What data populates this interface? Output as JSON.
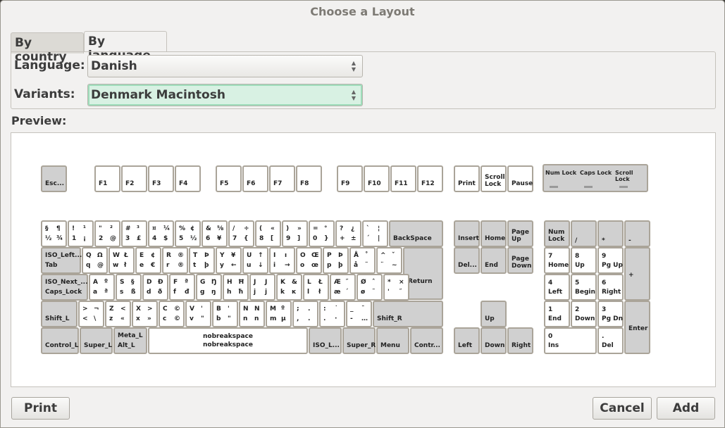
{
  "window": {
    "title": "Choose a Layout"
  },
  "tabs": [
    {
      "label": "By country"
    },
    {
      "label": "By language"
    }
  ],
  "language": {
    "label": "Language:",
    "value": "Danish"
  },
  "variants": {
    "label": "Variants:",
    "value": "Denmark Macintosh"
  },
  "preview": {
    "label": "Preview:"
  },
  "buttons": {
    "print": "Print",
    "cancel": "Cancel",
    "add": "Add"
  },
  "keyboard": {
    "indicators": [
      "Num Lock",
      "Caps Lock",
      "Scroll Lock"
    ],
    "function_row": [
      [
        "Esc...",
        ""
      ],
      [
        "F1",
        ""
      ],
      [
        "F2",
        ""
      ],
      [
        "F3",
        ""
      ],
      [
        "F4",
        ""
      ],
      [
        "F5",
        ""
      ],
      [
        "F6",
        ""
      ],
      [
        "F7",
        ""
      ],
      [
        "F8",
        ""
      ],
      [
        "F9",
        ""
      ],
      [
        "F10",
        ""
      ],
      [
        "F11",
        ""
      ],
      [
        "F12",
        ""
      ],
      [
        "Print",
        ""
      ],
      [
        "Scroll Lock",
        ""
      ],
      [
        "Pause",
        ""
      ]
    ],
    "main": [
      [
        [
          "§",
          "¶",
          "½",
          "¾"
        ],
        [
          "!",
          "¹",
          "1",
          "¡"
        ],
        [
          "\"",
          "²",
          "2",
          "@"
        ],
        [
          "#",
          "³",
          "3",
          "£"
        ],
        [
          "¤",
          "¼",
          "4",
          "$"
        ],
        [
          "%",
          "¢",
          "5",
          "½"
        ],
        [
          "&",
          "⅝",
          "6",
          "¥"
        ],
        [
          "/",
          "÷",
          "7",
          "{"
        ],
        [
          "(",
          "«",
          "8",
          "["
        ],
        [
          ")",
          "»",
          "9",
          "]"
        ],
        [
          "=",
          "°",
          "0",
          "}"
        ],
        [
          "?",
          "¿",
          "+",
          "±"
        ],
        [
          "`",
          "¦",
          "´",
          "|"
        ],
        [
          "",
          "",
          "BackSpace",
          ""
        ]
      ],
      [
        [
          "ISO_Left...",
          "",
          "Tab",
          ""
        ],
        [
          "Q",
          "Ω",
          "q",
          "@"
        ],
        [
          "W",
          "Ł",
          "w",
          "ł"
        ],
        [
          "E",
          "¢",
          "e",
          "€"
        ],
        [
          "R",
          "®",
          "r",
          "®"
        ],
        [
          "T",
          "Þ",
          "t",
          "þ"
        ],
        [
          "Y",
          "¥",
          "y",
          "←"
        ],
        [
          "U",
          "↑",
          "u",
          "↓"
        ],
        [
          "I",
          "ı",
          "i",
          "→"
        ],
        [
          "O",
          "Œ",
          "o",
          "œ"
        ],
        [
          "P",
          "Þ",
          "p",
          "þ"
        ],
        [
          "Å",
          "˚",
          "å",
          "¨"
        ],
        [
          "^",
          "ˇ",
          "¨",
          "~"
        ],
        [
          "",
          "Return",
          "",
          ""
        ]
      ],
      [
        [
          "ISO_Next_...",
          "",
          "Caps_Lock",
          ""
        ],
        [
          "A",
          "º",
          "a",
          "ª"
        ],
        [
          "S",
          "§",
          "s",
          "ß"
        ],
        [
          "D",
          "Ð",
          "d",
          "ð"
        ],
        [
          "F",
          "ª",
          "f",
          "đ"
        ],
        [
          "G",
          "Ŋ",
          "g",
          "ŋ"
        ],
        [
          "H",
          "Ħ",
          "h",
          "ħ"
        ],
        [
          "J",
          "J",
          "j",
          "j"
        ],
        [
          "K",
          "&",
          "k",
          "ĸ"
        ],
        [
          "L",
          "Ł",
          "l",
          "ł"
        ],
        [
          "Æ",
          "˝",
          "æ",
          "´"
        ],
        [
          "Ø",
          "ˆ",
          "ø",
          "˜"
        ],
        [
          "*",
          "×",
          "'",
          "˝"
        ]
      ],
      [
        [
          "",
          "",
          "Shift_L",
          ""
        ],
        [
          ">",
          "¬",
          "<",
          "\\"
        ],
        [
          "Z",
          "<",
          "z",
          "«"
        ],
        [
          "X",
          ">",
          "x",
          "»"
        ],
        [
          "C",
          "©",
          "c",
          "©"
        ],
        [
          "V",
          "'",
          "v",
          "\""
        ],
        [
          "B",
          "'",
          "b",
          "\""
        ],
        [
          "N",
          "N",
          "n",
          "n"
        ],
        [
          "M",
          "º",
          "m",
          "µ"
        ],
        [
          ";",
          ".",
          ",",
          "."
        ],
        [
          ":",
          "˙",
          ".",
          "·"
        ],
        [
          "_",
          "¯",
          "-",
          "…"
        ],
        [
          "",
          "",
          "Shift_R",
          ""
        ]
      ],
      [
        [
          "",
          "",
          "Control_L",
          ""
        ],
        [
          "",
          "",
          "Super_L",
          ""
        ],
        [
          "Meta_L",
          "",
          "Alt_L",
          ""
        ],
        [
          "nobreakspace",
          "",
          "nobreakspace",
          ""
        ],
        [
          "",
          "",
          "ISO_L...",
          ""
        ],
        [
          "",
          "",
          "Super_R",
          ""
        ],
        [
          "",
          "",
          "Menu",
          ""
        ],
        [
          "",
          "",
          "Contr...",
          ""
        ]
      ]
    ],
    "nav": [
      [
        "",
        "Insert"
      ],
      [
        "",
        "Home"
      ],
      [
        "Page Up",
        ""
      ],
      [
        "",
        "Del..."
      ],
      [
        "",
        "End"
      ],
      [
        "Page Down",
        ""
      ],
      [
        "",
        "Up"
      ],
      [
        "",
        "Left"
      ],
      [
        "",
        "Down"
      ],
      [
        "",
        "Right"
      ]
    ],
    "numpad": [
      [
        "Num Lock",
        ""
      ],
      [
        "",
        "/"
      ],
      [
        "",
        "*"
      ],
      [
        "",
        "-"
      ],
      [
        "7",
        "Home"
      ],
      [
        "8",
        "Up"
      ],
      [
        "9",
        "Pg Up"
      ],
      [
        "",
        "+"
      ],
      [
        "4",
        "Left"
      ],
      [
        "5",
        "Begin"
      ],
      [
        "6",
        "Right"
      ],
      [
        "1",
        "End"
      ],
      [
        "2",
        "Down"
      ],
      [
        "3",
        "Pg Dn"
      ],
      [
        "",
        "Enter"
      ],
      [
        "0",
        "Ins"
      ],
      [
        ".",
        "Del"
      ]
    ]
  }
}
